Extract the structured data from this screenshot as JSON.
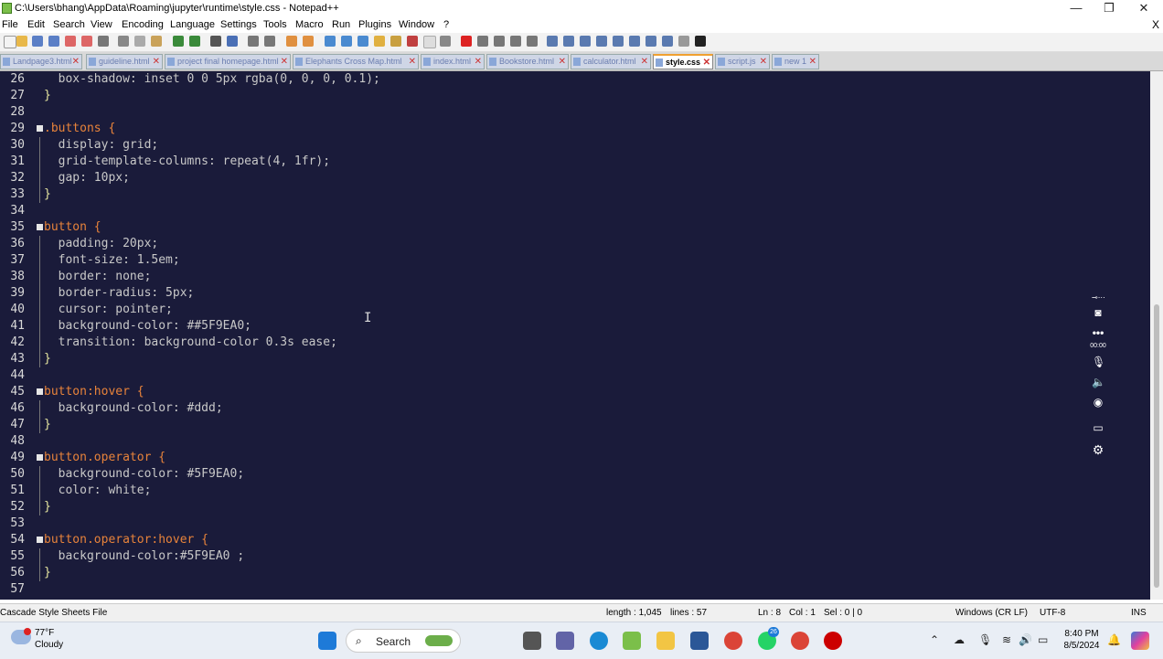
{
  "window": {
    "title": "C:\\Users\\bhang\\AppData\\Roaming\\jupyter\\runtime\\style.css - Notepad++",
    "minimize": "—",
    "maximize": "❐",
    "close": "✕"
  },
  "menu": {
    "items": [
      "File",
      "Edit",
      "Search",
      "View",
      "Encoding",
      "Language",
      "Settings",
      "Tools",
      "Macro",
      "Run",
      "Plugins",
      "Window",
      "?"
    ],
    "close_doc": "X"
  },
  "tabs": [
    {
      "label": "Landpage3.html",
      "active": false
    },
    {
      "label": "guideline.html",
      "active": false
    },
    {
      "label": "project final homepage.html",
      "active": false
    },
    {
      "label": "Elephants Cross Map.html",
      "active": false
    },
    {
      "label": "index.html",
      "active": false
    },
    {
      "label": "Bookstore.html",
      "active": false
    },
    {
      "label": "calculator.html",
      "active": false
    },
    {
      "label": "style.css",
      "active": true
    },
    {
      "label": "script.js",
      "active": false
    },
    {
      "label": "new 1",
      "active": false
    }
  ],
  "code_lines": [
    {
      "n": "26",
      "text": "  box-shadow: inset 0 0 5px rgba(0, 0, 0, 0.1);"
    },
    {
      "n": "27",
      "text": "}"
    },
    {
      "n": "28",
      "text": ""
    },
    {
      "n": "29",
      "text": ".buttons {"
    },
    {
      "n": "30",
      "text": "  display: grid;"
    },
    {
      "n": "31",
      "text": "  grid-template-columns: repeat(4, 1fr);"
    },
    {
      "n": "32",
      "text": "  gap: 10px;"
    },
    {
      "n": "33",
      "text": "}"
    },
    {
      "n": "34",
      "text": ""
    },
    {
      "n": "35",
      "text": "button {"
    },
    {
      "n": "36",
      "text": "  padding: 20px;"
    },
    {
      "n": "37",
      "text": "  font-size: 1.5em;"
    },
    {
      "n": "38",
      "text": "  border: none;"
    },
    {
      "n": "39",
      "text": "  border-radius: 5px;"
    },
    {
      "n": "40",
      "text": "  cursor: pointer;"
    },
    {
      "n": "41",
      "text": "  background-color: ##5F9EA0;"
    },
    {
      "n": "42",
      "text": "  transition: background-color 0.3s ease;"
    },
    {
      "n": "43",
      "text": "}"
    },
    {
      "n": "44",
      "text": ""
    },
    {
      "n": "45",
      "text": "button:hover {"
    },
    {
      "n": "46",
      "text": "  background-color: #ddd;"
    },
    {
      "n": "47",
      "text": "}"
    },
    {
      "n": "48",
      "text": ""
    },
    {
      "n": "49",
      "text": "button.operator {"
    },
    {
      "n": "50",
      "text": "  background-color: #5F9EA0;"
    },
    {
      "n": "51",
      "text": "  color: white;"
    },
    {
      "n": "52",
      "text": "}"
    },
    {
      "n": "53",
      "text": ""
    },
    {
      "n": "54",
      "text": "button.operator:hover {"
    },
    {
      "n": "55",
      "text": "  background-color:#5F9EA0 ;"
    },
    {
      "n": "56",
      "text": "}"
    },
    {
      "n": "57",
      "text": ""
    }
  ],
  "status": {
    "file_type": "Cascade Style Sheets File",
    "length": "length : 1,045",
    "lines": "lines : 57",
    "position": "Ln : 8",
    "column": "Col : 1",
    "selection": "Sel : 0 | 0",
    "eol": "Windows (CR LF)",
    "encoding": "UTF-8",
    "mode": "INS"
  },
  "recorder_overlay": {
    "timer": "00:00"
  },
  "taskbar": {
    "weather_temp": "77°F",
    "weather_desc": "Cloudy",
    "search_label": "Search",
    "whatsapp_badge": "26",
    "time": "8:40 PM",
    "date": "8/5/2024"
  },
  "colors": {
    "editor_bg": "#1a1b3a",
    "selector": "#e8833a",
    "value": "#d9d97a",
    "accent_tab": "#f0a030"
  }
}
